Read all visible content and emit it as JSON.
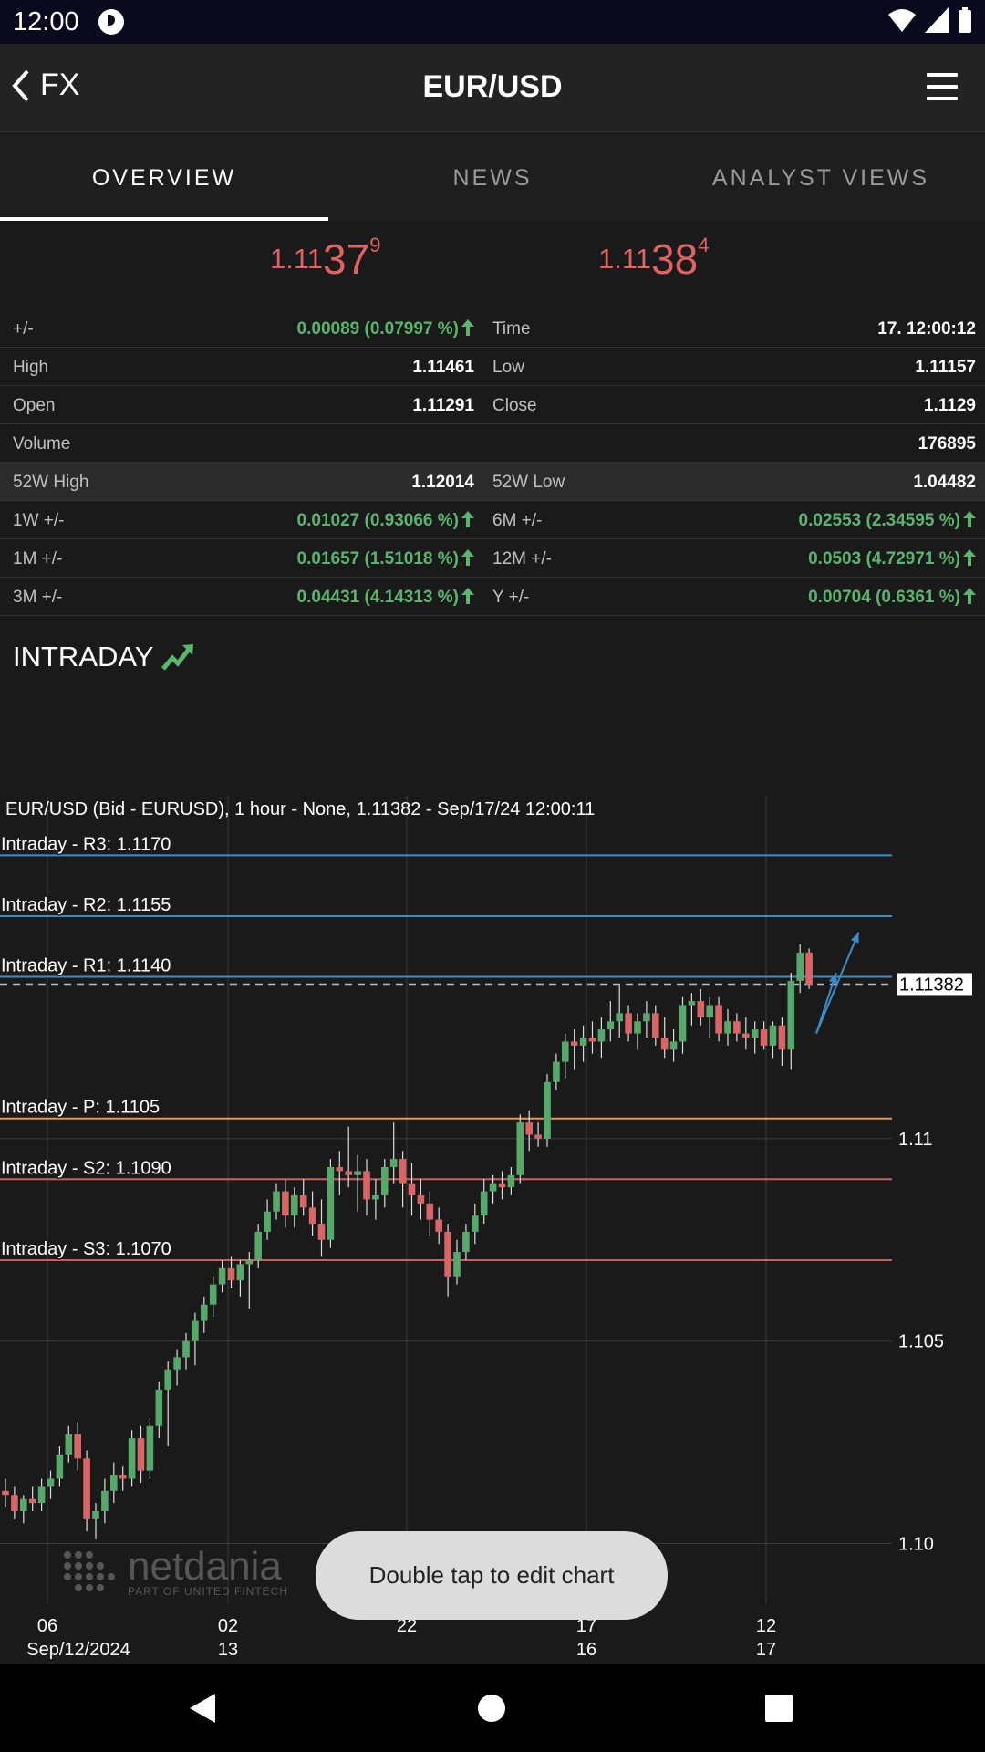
{
  "status_bar": {
    "time": "12:00"
  },
  "app_bar": {
    "back_label": "FX",
    "title": "EUR/USD"
  },
  "tabs": [
    {
      "label": "OVERVIEW",
      "active": true
    },
    {
      "label": "NEWS",
      "active": false
    },
    {
      "label": "ANALYST VIEWS",
      "active": false
    }
  ],
  "quotes": {
    "bid": {
      "prefix": "1.11",
      "big": "37",
      "sup": "9"
    },
    "ask": {
      "prefix": "1.11",
      "big": "38",
      "sup": "4"
    }
  },
  "stats": [
    {
      "l1": "+/-",
      "v1": "0.00089 (0.07997 %)",
      "up1": true,
      "l2": "Time",
      "v2": "17. 12:00:12",
      "up2": false
    },
    {
      "l1": "High",
      "v1": "1.11461",
      "up1": false,
      "l2": "Low",
      "v2": "1.11157",
      "up2": false
    },
    {
      "l1": "Open",
      "v1": "1.11291",
      "up1": false,
      "l2": "Close",
      "v2": "1.1129",
      "up2": false
    },
    {
      "l1": "Volume",
      "v1": "",
      "up1": false,
      "l2": "",
      "v2": "176895",
      "up2": false
    },
    {
      "l1": "52W High",
      "v1": "1.12014",
      "up1": false,
      "l2": "52W Low",
      "v2": "1.04482",
      "up2": false
    },
    {
      "l1": "1W +/-",
      "v1": "0.01027 (0.93066 %)",
      "up1": true,
      "l2": "6M +/-",
      "v2": "0.02553 (2.34595 %)",
      "up2": true
    },
    {
      "l1": "1M +/-",
      "v1": "0.01657 (1.51018 %)",
      "up1": true,
      "l2": "12M +/-",
      "v2": "0.0503 (4.72971 %)",
      "up2": true
    },
    {
      "l1": "3M +/-",
      "v1": "0.04431 (4.14313 %)",
      "up1": true,
      "l2": "Y +/-",
      "v2": "0.00704 (0.6361 %)",
      "up2": true
    }
  ],
  "intraday_label": "INTRADAY",
  "chart_title": "EUR/USD (Bid - EURUSD),  1 hour - None, 1.11382 - Sep/17/24 12:00:11",
  "chart_data": {
    "type": "candlestick",
    "ylim": [
      1.0985,
      1.1187
    ],
    "y_ticks": [
      {
        "v": 1.1,
        "label": "1.10"
      },
      {
        "v": 1.105,
        "label": "1.105"
      },
      {
        "v": 1.11,
        "label": "1.11"
      }
    ],
    "current_price": {
      "value": 1.11382,
      "label": "1.11382"
    },
    "levels": [
      {
        "label": "Intraday - R3: 1.1170",
        "value": 1.117,
        "color": "#3a8dc9"
      },
      {
        "label": "Intraday - R2: 1.1155",
        "value": 1.1155,
        "color": "#3a8dc9"
      },
      {
        "label": "Intraday - R1: 1.1140",
        "value": 1.114,
        "color": "#3a8dc9"
      },
      {
        "label": "Intraday - P: 1.1105",
        "value": 1.1105,
        "color": "#e0955a"
      },
      {
        "label": "Intraday - S2: 1.1090",
        "value": 1.109,
        "color": "#c96060"
      },
      {
        "label": "Intraday - S3: 1.1070",
        "value": 1.107,
        "color": "#c96060"
      }
    ],
    "x_ticks": [
      {
        "top": "06",
        "bottom": "Sep/12/2024"
      },
      {
        "top": "02",
        "bottom": "13"
      },
      {
        "top": "22",
        "bottom": ""
      },
      {
        "top": "17",
        "bottom": "16"
      },
      {
        "top": "12",
        "bottom": "17"
      }
    ],
    "candles": [
      {
        "o": 1.1013,
        "h": 1.1016,
        "l": 1.1009,
        "c": 1.1012
      },
      {
        "o": 1.1012,
        "h": 1.1014,
        "l": 1.1006,
        "c": 1.1008
      },
      {
        "o": 1.1008,
        "h": 1.1012,
        "l": 1.1005,
        "c": 1.1011
      },
      {
        "o": 1.1011,
        "h": 1.1014,
        "l": 1.1008,
        "c": 1.101
      },
      {
        "o": 1.101,
        "h": 1.1016,
        "l": 1.1008,
        "c": 1.1014
      },
      {
        "o": 1.1014,
        "h": 1.1018,
        "l": 1.1011,
        "c": 1.1016
      },
      {
        "o": 1.1016,
        "h": 1.1024,
        "l": 1.1014,
        "c": 1.1022
      },
      {
        "o": 1.1022,
        "h": 1.1029,
        "l": 1.102,
        "c": 1.1027
      },
      {
        "o": 1.1027,
        "h": 1.103,
        "l": 1.1018,
        "c": 1.1021
      },
      {
        "o": 1.1021,
        "h": 1.1023,
        "l": 1.1003,
        "c": 1.1006
      },
      {
        "o": 1.1006,
        "h": 1.101,
        "l": 1.1001,
        "c": 1.1008
      },
      {
        "o": 1.1008,
        "h": 1.1016,
        "l": 1.1005,
        "c": 1.1013
      },
      {
        "o": 1.1013,
        "h": 1.102,
        "l": 1.101,
        "c": 1.1017
      },
      {
        "o": 1.1017,
        "h": 1.1019,
        "l": 1.1013,
        "c": 1.1016
      },
      {
        "o": 1.1016,
        "h": 1.1028,
        "l": 1.1014,
        "c": 1.1026
      },
      {
        "o": 1.1026,
        "h": 1.1029,
        "l": 1.1015,
        "c": 1.1018
      },
      {
        "o": 1.1018,
        "h": 1.1031,
        "l": 1.1016,
        "c": 1.1029
      },
      {
        "o": 1.1029,
        "h": 1.104,
        "l": 1.1026,
        "c": 1.1038
      },
      {
        "o": 1.1038,
        "h": 1.1045,
        "l": 1.1024,
        "c": 1.1043
      },
      {
        "o": 1.1043,
        "h": 1.1048,
        "l": 1.1039,
        "c": 1.1046
      },
      {
        "o": 1.1046,
        "h": 1.1052,
        "l": 1.1043,
        "c": 1.105
      },
      {
        "o": 1.105,
        "h": 1.1057,
        "l": 1.1044,
        "c": 1.1055
      },
      {
        "o": 1.1055,
        "h": 1.1061,
        "l": 1.1052,
        "c": 1.1059
      },
      {
        "o": 1.1059,
        "h": 1.1066,
        "l": 1.1056,
        "c": 1.1064
      },
      {
        "o": 1.1064,
        "h": 1.107,
        "l": 1.1062,
        "c": 1.1068
      },
      {
        "o": 1.1068,
        "h": 1.1071,
        "l": 1.1063,
        "c": 1.1065
      },
      {
        "o": 1.1065,
        "h": 1.107,
        "l": 1.1061,
        "c": 1.1069
      },
      {
        "o": 1.1069,
        "h": 1.1072,
        "l": 1.1058,
        "c": 1.107
      },
      {
        "o": 1.107,
        "h": 1.1079,
        "l": 1.1068,
        "c": 1.1077
      },
      {
        "o": 1.1077,
        "h": 1.1085,
        "l": 1.1075,
        "c": 1.1082
      },
      {
        "o": 1.1082,
        "h": 1.1089,
        "l": 1.108,
        "c": 1.1087
      },
      {
        "o": 1.1087,
        "h": 1.109,
        "l": 1.1078,
        "c": 1.1081
      },
      {
        "o": 1.1081,
        "h": 1.1088,
        "l": 1.1078,
        "c": 1.1086
      },
      {
        "o": 1.1086,
        "h": 1.109,
        "l": 1.1081,
        "c": 1.1083
      },
      {
        "o": 1.1083,
        "h": 1.1087,
        "l": 1.1076,
        "c": 1.1079
      },
      {
        "o": 1.1079,
        "h": 1.1085,
        "l": 1.1071,
        "c": 1.1075
      },
      {
        "o": 1.1075,
        "h": 1.1095,
        "l": 1.1073,
        "c": 1.1093
      },
      {
        "o": 1.1093,
        "h": 1.1097,
        "l": 1.1086,
        "c": 1.1092
      },
      {
        "o": 1.1092,
        "h": 1.1103,
        "l": 1.1088,
        "c": 1.1091
      },
      {
        "o": 1.1091,
        "h": 1.1096,
        "l": 1.1082,
        "c": 1.1092
      },
      {
        "o": 1.1092,
        "h": 1.1095,
        "l": 1.1081,
        "c": 1.1085
      },
      {
        "o": 1.1085,
        "h": 1.109,
        "l": 1.108,
        "c": 1.1086
      },
      {
        "o": 1.1086,
        "h": 1.1095,
        "l": 1.1083,
        "c": 1.1093
      },
      {
        "o": 1.1093,
        "h": 1.1104,
        "l": 1.1089,
        "c": 1.1095
      },
      {
        "o": 1.1095,
        "h": 1.1097,
        "l": 1.1083,
        "c": 1.1089
      },
      {
        "o": 1.1089,
        "h": 1.1094,
        "l": 1.1081,
        "c": 1.1086
      },
      {
        "o": 1.1086,
        "h": 1.109,
        "l": 1.108,
        "c": 1.1084
      },
      {
        "o": 1.1084,
        "h": 1.1087,
        "l": 1.1076,
        "c": 1.108
      },
      {
        "o": 1.108,
        "h": 1.1083,
        "l": 1.1074,
        "c": 1.1077
      },
      {
        "o": 1.1077,
        "h": 1.1079,
        "l": 1.1061,
        "c": 1.1066
      },
      {
        "o": 1.1066,
        "h": 1.1075,
        "l": 1.1064,
        "c": 1.1072
      },
      {
        "o": 1.1072,
        "h": 1.1079,
        "l": 1.107,
        "c": 1.1077
      },
      {
        "o": 1.1077,
        "h": 1.1084,
        "l": 1.1074,
        "c": 1.1081
      },
      {
        "o": 1.1081,
        "h": 1.109,
        "l": 1.1079,
        "c": 1.1087
      },
      {
        "o": 1.1087,
        "h": 1.1091,
        "l": 1.1084,
        "c": 1.1089
      },
      {
        "o": 1.1089,
        "h": 1.1092,
        "l": 1.1085,
        "c": 1.1088
      },
      {
        "o": 1.1088,
        "h": 1.1093,
        "l": 1.1086,
        "c": 1.1091
      },
      {
        "o": 1.1091,
        "h": 1.1106,
        "l": 1.1089,
        "c": 1.1104
      },
      {
        "o": 1.1104,
        "h": 1.1107,
        "l": 1.1097,
        "c": 1.1101
      },
      {
        "o": 1.1101,
        "h": 1.1104,
        "l": 1.1098,
        "c": 1.11
      },
      {
        "o": 1.11,
        "h": 1.1116,
        "l": 1.1098,
        "c": 1.1114
      },
      {
        "o": 1.1114,
        "h": 1.1121,
        "l": 1.1112,
        "c": 1.1119
      },
      {
        "o": 1.1119,
        "h": 1.1126,
        "l": 1.1115,
        "c": 1.1124
      },
      {
        "o": 1.1124,
        "h": 1.1127,
        "l": 1.1117,
        "c": 1.1123
      },
      {
        "o": 1.1123,
        "h": 1.1128,
        "l": 1.1119,
        "c": 1.1125
      },
      {
        "o": 1.1125,
        "h": 1.1129,
        "l": 1.1121,
        "c": 1.1124
      },
      {
        "o": 1.1124,
        "h": 1.113,
        "l": 1.112,
        "c": 1.1127
      },
      {
        "o": 1.1127,
        "h": 1.1134,
        "l": 1.1124,
        "c": 1.1129
      },
      {
        "o": 1.1129,
        "h": 1.1138,
        "l": 1.1125,
        "c": 1.1131
      },
      {
        "o": 1.1131,
        "h": 1.1133,
        "l": 1.1124,
        "c": 1.1126
      },
      {
        "o": 1.1126,
        "h": 1.1131,
        "l": 1.1122,
        "c": 1.1129
      },
      {
        "o": 1.1129,
        "h": 1.1134,
        "l": 1.1125,
        "c": 1.1131
      },
      {
        "o": 1.1131,
        "h": 1.1133,
        "l": 1.1123,
        "c": 1.1125
      },
      {
        "o": 1.1125,
        "h": 1.113,
        "l": 1.112,
        "c": 1.1122
      },
      {
        "o": 1.1122,
        "h": 1.1127,
        "l": 1.1119,
        "c": 1.1124
      },
      {
        "o": 1.1124,
        "h": 1.1135,
        "l": 1.1121,
        "c": 1.1133
      },
      {
        "o": 1.1133,
        "h": 1.1136,
        "l": 1.1128,
        "c": 1.1134
      },
      {
        "o": 1.1134,
        "h": 1.1137,
        "l": 1.1128,
        "c": 1.113
      },
      {
        "o": 1.113,
        "h": 1.1135,
        "l": 1.1125,
        "c": 1.1133
      },
      {
        "o": 1.1133,
        "h": 1.1135,
        "l": 1.1124,
        "c": 1.1126
      },
      {
        "o": 1.1126,
        "h": 1.1132,
        "l": 1.1123,
        "c": 1.1129
      },
      {
        "o": 1.1129,
        "h": 1.1131,
        "l": 1.1124,
        "c": 1.1126
      },
      {
        "o": 1.1126,
        "h": 1.113,
        "l": 1.1122,
        "c": 1.1125
      },
      {
        "o": 1.1125,
        "h": 1.1129,
        "l": 1.1121,
        "c": 1.1127
      },
      {
        "o": 1.1127,
        "h": 1.1129,
        "l": 1.1122,
        "c": 1.1123
      },
      {
        "o": 1.1123,
        "h": 1.1129,
        "l": 1.112,
        "c": 1.1128
      },
      {
        "o": 1.1128,
        "h": 1.113,
        "l": 1.1118,
        "c": 1.1122
      },
      {
        "o": 1.1122,
        "h": 1.1141,
        "l": 1.1117,
        "c": 1.1139
      },
      {
        "o": 1.1139,
        "h": 1.1148,
        "l": 1.1136,
        "c": 1.1146
      },
      {
        "o": 1.1146,
        "h": 1.1147,
        "l": 1.1137,
        "c": 1.1138
      }
    ],
    "projections": [
      {
        "from": [
          89.8,
          1.1126
        ],
        "to": [
          94.5,
          1.1151
        ]
      },
      {
        "from": [
          89.8,
          1.1126
        ],
        "to": [
          92.0,
          1.1141
        ]
      }
    ],
    "colors": {
      "up": "#56a86b",
      "down": "#d96566",
      "grid": "#3a3a3a",
      "text": "#ffffff",
      "projection": "#3a8dc9"
    }
  },
  "toast": "Double tap to edit chart",
  "logo": {
    "name": "netdania",
    "sub": "PART OF UNITED FINTECH"
  }
}
